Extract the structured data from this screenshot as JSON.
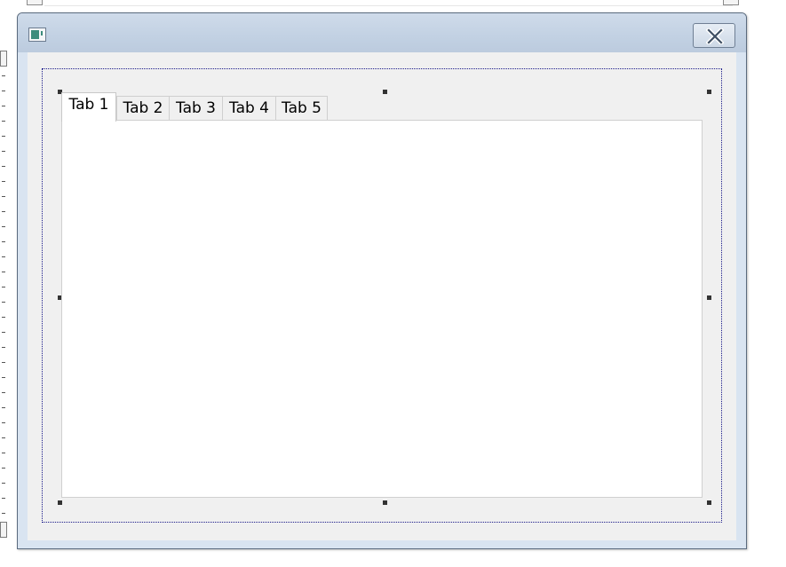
{
  "window": {
    "close_label": "×"
  },
  "tabs": [
    {
      "label": "Tab 1",
      "active": true
    },
    {
      "label": "Tab 2",
      "active": false
    },
    {
      "label": "Tab 3",
      "active": false
    },
    {
      "label": "Tab 4",
      "active": false
    },
    {
      "label": "Tab 5",
      "active": false
    }
  ],
  "icons": {
    "app": "app-window-icon",
    "close": "close-icon"
  },
  "colors": {
    "titlebar": "#c2d1e3",
    "client": "#f0f0f0",
    "selection_outline": "#1a1a8a",
    "tab_pane": "#ffffff"
  }
}
